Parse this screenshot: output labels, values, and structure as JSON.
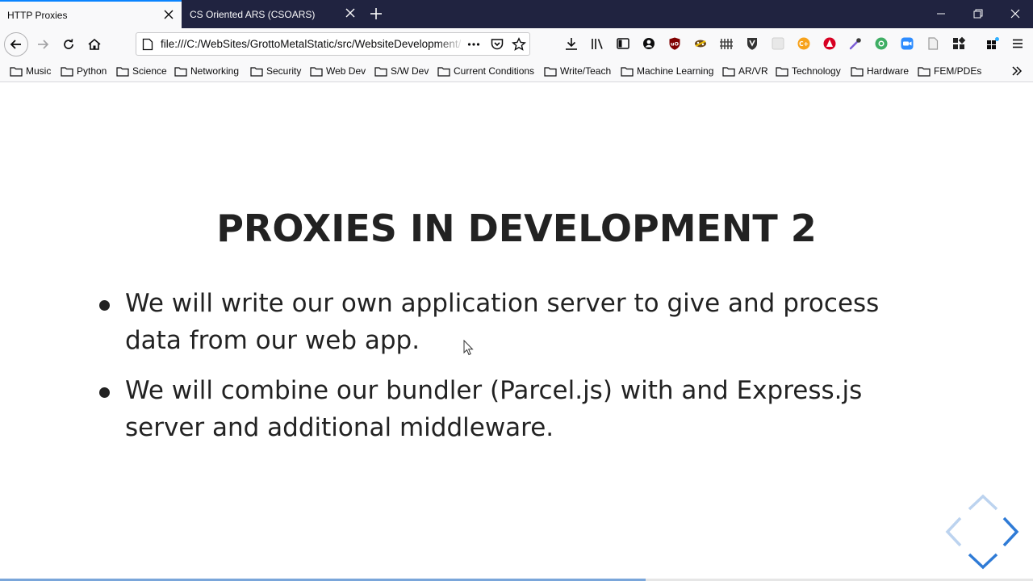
{
  "tabs": [
    {
      "title": "HTTP Proxies",
      "active": true
    },
    {
      "title": "CS Oriented ARS (CSOARS)",
      "active": false
    }
  ],
  "navbar": {
    "url": "file:///C:/WebSites/GrottoMetalStatic/src/WebsiteDevelopment/"
  },
  "bookmarks": [
    "Music",
    "Python",
    "Science",
    "Networking",
    "Security",
    "Web Dev",
    "S/W Dev",
    "Current Conditions",
    "Write/Teach",
    "Machine Learning",
    "AR/VR",
    "Technology",
    "Hardware",
    "FEM/PDEs"
  ],
  "slide": {
    "title": "PROXIES IN DEVELOPMENT 2",
    "bullets": [
      "We will write our own application server to give and process data from our web app.",
      "We will combine our bundler (Parcel.js) with and Express.js server and additional middleware."
    ],
    "progress_fraction": 0.625
  },
  "colors": {
    "tabstrip": "#202340",
    "accent": "#0a84ff",
    "slide_text": "#222222",
    "nav_controls": "#2f7bd6"
  }
}
